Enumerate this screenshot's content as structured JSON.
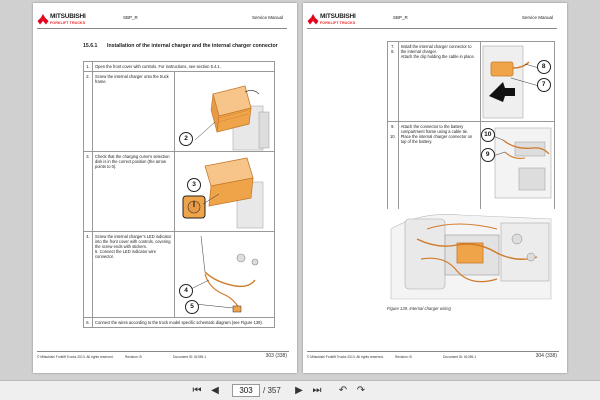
{
  "header": {
    "brand": "MITSUBISHI",
    "brand_sub": "FORKLIFT TRUCKS",
    "model": "SBP_R",
    "manual": "Service Manual"
  },
  "section": {
    "number": "15.6.1",
    "title": "Installation of the internal charger and the internal charger connector"
  },
  "left_steps": [
    {
      "n": "1.",
      "text": "Open the front cover with controls. For instructions, see section 5.4.1."
    },
    {
      "n": "2.",
      "text": "Screw the internal charger onto the truck frame."
    },
    {
      "n": "3.",
      "text": "Check that the charging curve's selection disk is in the correct position (the arrow points to 0)."
    },
    {
      "n": "4.",
      "text": "Screw the internal charger's LED indicator into the front cover with controls, covering the screw ends with stickers."
    },
    {
      "n": "5.",
      "text": "Connect the LED indicator wire connector."
    },
    {
      "n": "6.",
      "text": "Connect the wires according to the truck model specific schematic diagram (see Figure 139)."
    }
  ],
  "right_steps": [
    {
      "n": "7.",
      "text": "Install the internal charger connector to the internal charger."
    },
    {
      "n": "8.",
      "text": "Attach the clip holding the cable in place."
    },
    {
      "n": "9.",
      "text": "Attach the connector to the battery compartment frame using a cable tie."
    },
    {
      "n": "10.",
      "text": "Place the internal charger connector on top of the battery."
    }
  ],
  "callouts": {
    "c2": "2",
    "c3": "3",
    "c4": "4",
    "c5": "5",
    "c7": "7",
    "c8": "8",
    "c9": "9",
    "c10": "10"
  },
  "figure_caption": "Figure 139. Internal charger wiring",
  "footer_left": {
    "copyright": "© Mitsubishi Forklift Trucks 2013. All rights reserved.",
    "revision": "Revision: B",
    "document": "Document ID: 61059-1",
    "page": "303 (338)"
  },
  "footer_right": {
    "copyright": "© Mitsubishi Forklift Trucks 2013. All rights reserved.",
    "revision": "Revision: B",
    "document": "Document ID: 61059-1",
    "page": "304 (338)"
  },
  "toolbar": {
    "current_page": "303",
    "total": "/ 357",
    "first_icon": "⏮",
    "prev_icon": "◀",
    "next_icon": "▶",
    "last_icon": "⏭",
    "back_icon": "↶",
    "forward_icon": "↷"
  },
  "colors": {
    "accent": "#e2001a",
    "charger": "#f0a44a",
    "wire": "#d07a2a"
  }
}
